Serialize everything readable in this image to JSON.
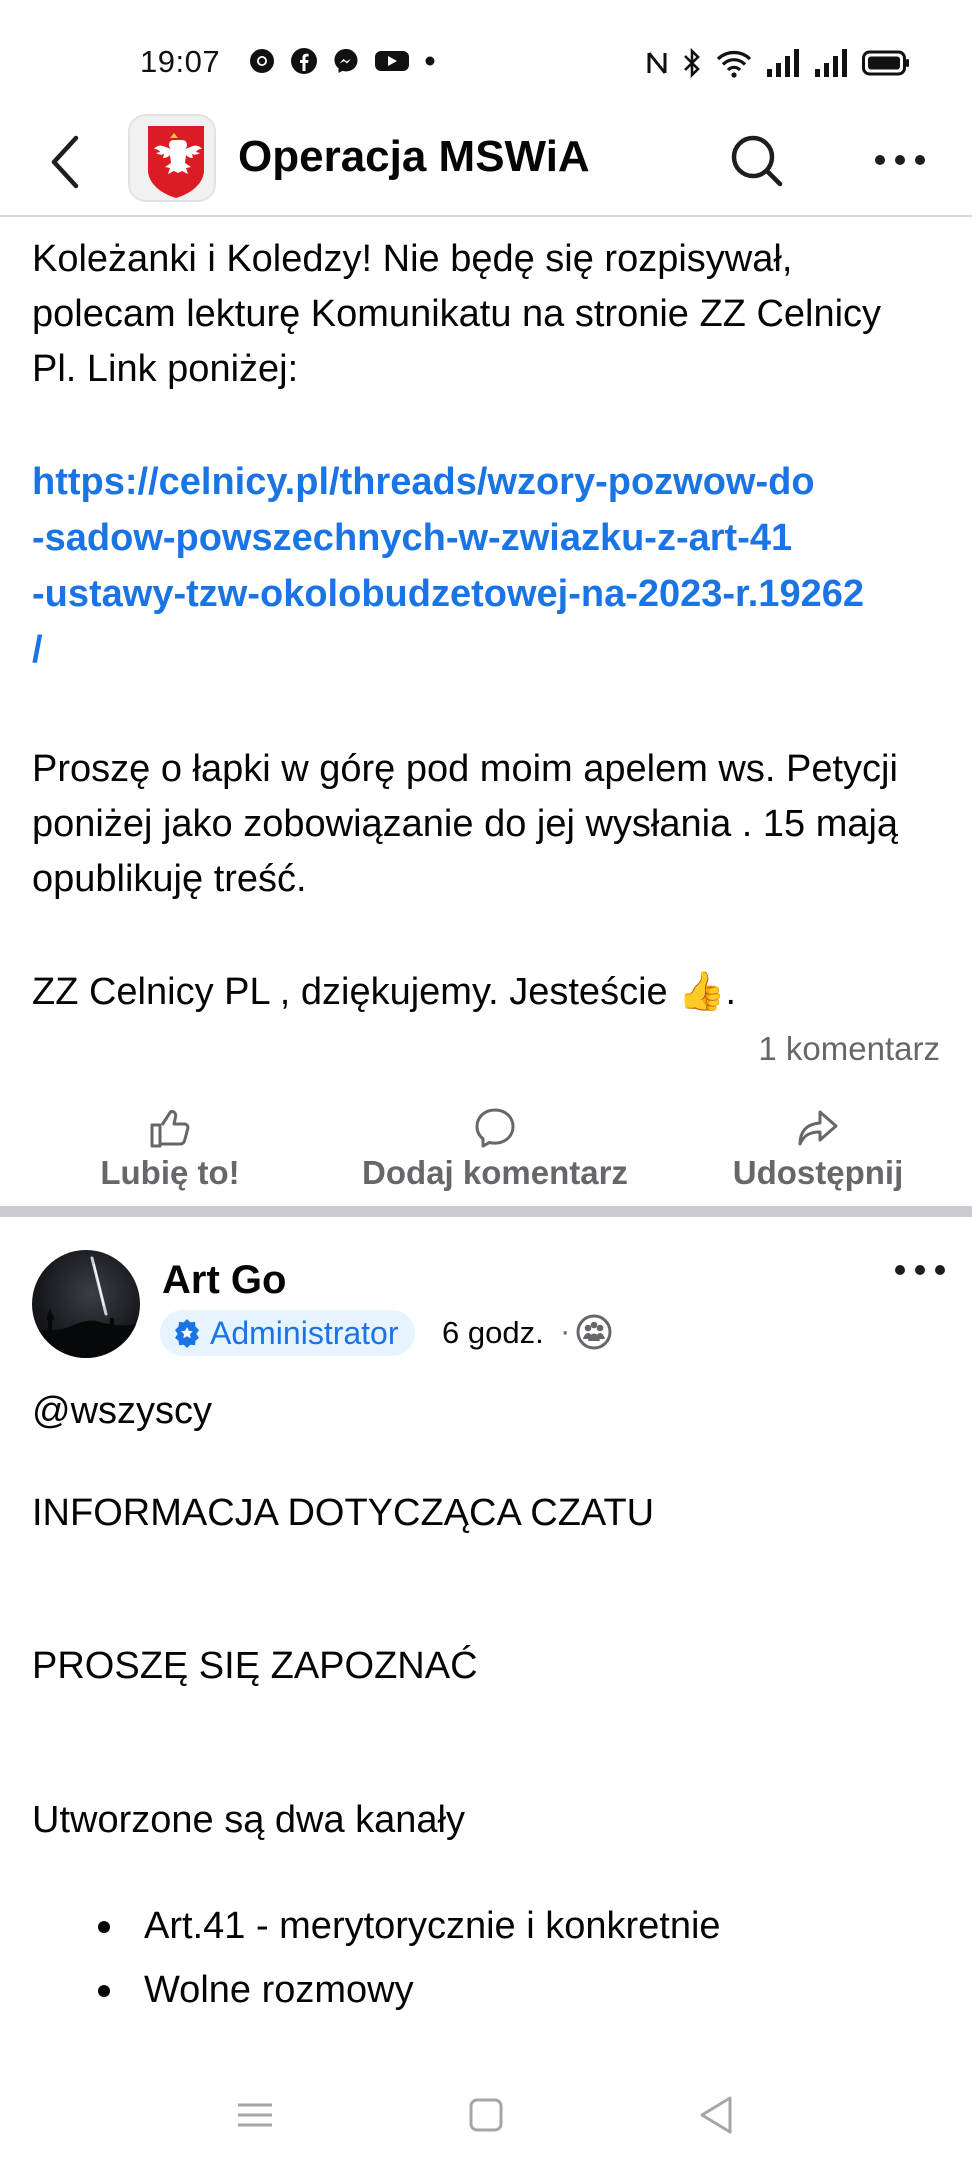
{
  "status_bar": {
    "time": "19:07",
    "notification_icons": [
      "chrome-icon",
      "facebook-icon",
      "messenger-icon",
      "youtube-icon",
      "more-notifications-dot"
    ],
    "system_icons": [
      "nfc-icon",
      "bluetooth-icon",
      "wifi-icon",
      "signal-icon",
      "signal-icon-2",
      "battery-icon"
    ]
  },
  "header": {
    "title": "Operacja MSWiA",
    "back_icon": "chevron-left-icon",
    "search_icon": "search-icon",
    "more_icon": "more-horizontal-icon"
  },
  "post1": {
    "paragraph1": "Koleżanki i Koledzy! Nie będę się rozpisywał, polecam lekturę Komunikatu na stronie ZZ Celnicy Pl. Link poniżej:",
    "link_lines": [
      "https://celnicy.pl/threads/wzory-pozwow-do",
      "-sadow-powszechnych-w-zwiazku-z-art-41",
      "-ustawy-tzw-okolobudzetowej-na-2023-r.19262",
      "/"
    ],
    "paragraph2": "Proszę o łapki w górę pod moim apelem ws. Petycji poniżej jako zobowiązanie do jej wysłania . 15 mają opublikuję treść.",
    "paragraph3": "ZZ Celnicy PL , dziękujemy. Jesteście",
    "paragraph3_emoji": "👍",
    "paragraph3_end": ".",
    "comment_count": "1 komentarz"
  },
  "actions": {
    "like_label": "Lubię to!",
    "comment_label": "Dodaj komentarz",
    "share_label": "Udostępnij"
  },
  "post2": {
    "author": "Art Go",
    "role": "Administrator",
    "time": "6 godz.",
    "dot": "·",
    "lines": {
      "mention": "@wszyscy",
      "heading": "INFORMACJA DOTYCZĄCA CZATU",
      "request": "PROSZĘ SIĘ ZAPOZNAĆ",
      "intro": "Utworzone są dwa kanały"
    },
    "bullets": [
      "Art.41 - merytorycznie i konkretnie",
      "Wolne rozmowy"
    ]
  },
  "nav_bar": {
    "icons": [
      "menu-icon",
      "home-square-icon",
      "back-triangle-icon"
    ]
  },
  "colors": {
    "link": "#1b74e4",
    "secondary_text": "#65676b",
    "badge_bg": "#e7f3ff",
    "separator": "#c9ccd1"
  }
}
